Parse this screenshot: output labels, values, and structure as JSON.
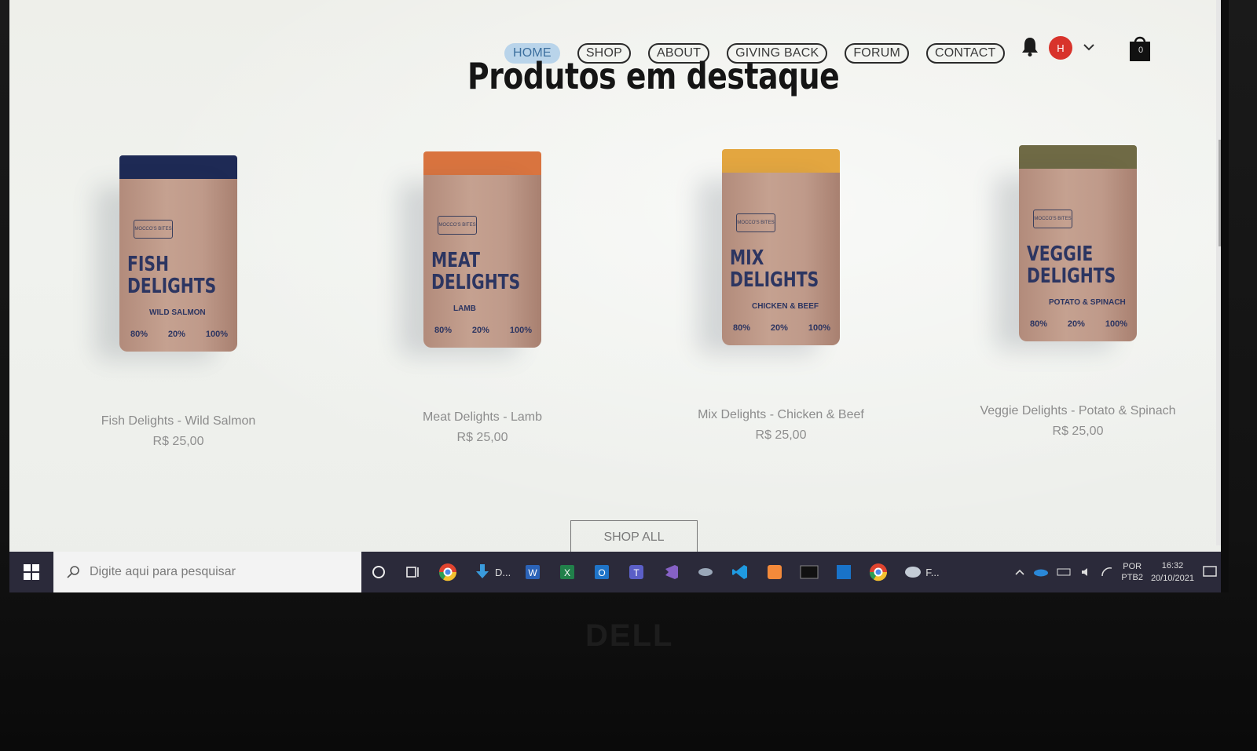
{
  "nav": {
    "links": [
      "HOME",
      "SHOP",
      "ABOUT",
      "GIVING BACK",
      "FORUM",
      "CONTACT"
    ],
    "active": "HOME",
    "avatar_initial": "H",
    "cart_count": "0"
  },
  "section": {
    "title": "Produtos em destaque"
  },
  "products": [
    {
      "name": "Fish Delights - Wild Salmon",
      "price": "R$ 25,00",
      "pouch_title_1": "FISH",
      "pouch_title_2": "DELIGHTS",
      "pouch_flavor": "WILD SALMON",
      "top_color": "#1e2a55"
    },
    {
      "name": "Meat Delights - Lamb",
      "price": "R$ 25,00",
      "pouch_title_1": "MEAT",
      "pouch_title_2": "DELIGHTS",
      "pouch_flavor": "LAMB",
      "top_color": "#d9743f"
    },
    {
      "name": "Mix Delights - Chicken & Beef",
      "price": "R$ 25,00",
      "pouch_title_1": "MIX",
      "pouch_title_2": "DELIGHTS",
      "pouch_flavor": "CHICKEN & BEEF",
      "top_color": "#e3a640"
    },
    {
      "name": "Veggie Delights - Potato & Spinach",
      "price": "R$ 25,00",
      "pouch_title_1": "VEGGIE",
      "pouch_title_2": "DELIGHTS",
      "pouch_flavor": "POTATO & SPINACH",
      "top_color": "#6f6a45"
    }
  ],
  "pouch_stats": [
    "80%",
    "20%",
    "100%"
  ],
  "pouch_brand": "MOCCO'S BITES",
  "shop_all": "SHOP ALL",
  "taskbar": {
    "search_placeholder": "Digite aqui para pesquisar",
    "download_label": "D...",
    "app_label": "F...",
    "lang_1": "POR",
    "lang_2": "PTB2",
    "time": "16:32",
    "date": "20/10/2021"
  },
  "bezel_brand": "DELL"
}
